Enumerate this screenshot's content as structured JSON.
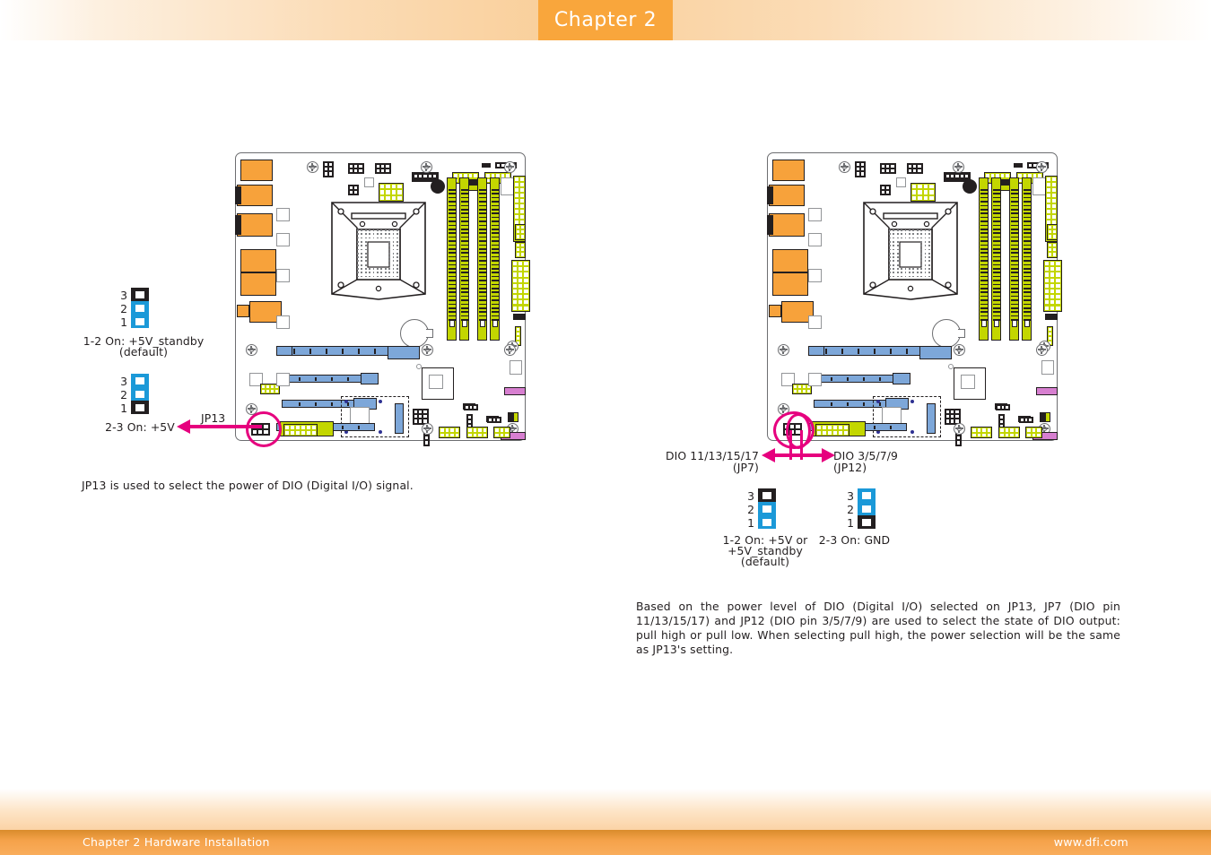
{
  "header": {
    "chapter_tab": "Chapter 2"
  },
  "footer": {
    "left": "Chapter 2 Hardware Installation",
    "right": "www.dfi.com"
  },
  "left_section": {
    "callout_label": "JP13",
    "jumpers": [
      {
        "id": "jp13-setting-1",
        "pins": [
          "3",
          "2",
          "1"
        ],
        "states": [
          "open",
          "capped",
          "capped"
        ],
        "caption": "1-2 On: +5V_standby",
        "caption2": "(default)"
      },
      {
        "id": "jp13-setting-2",
        "pins": [
          "3",
          "2",
          "1"
        ],
        "states": [
          "capped",
          "capped",
          "open"
        ],
        "caption": "2-3 On: +5V",
        "caption2": ""
      }
    ],
    "description": "JP13 is used to select the power of DIO (Digital I/O) signal."
  },
  "right_section": {
    "callout_left_line1": "DIO 11/13/15/17",
    "callout_left_line2": "(JP7)",
    "callout_right_line1": "DIO 3/5/7/9",
    "callout_right_line2": "(JP12)",
    "jumpers": [
      {
        "id": "jp7-setting",
        "pins": [
          "3",
          "2",
          "1"
        ],
        "states": [
          "open",
          "capped",
          "capped"
        ],
        "caption": "1-2 On: +5V or",
        "caption2": "+5V_standby",
        "caption3": "(default)"
      },
      {
        "id": "jp12-setting",
        "pins": [
          "3",
          "2",
          "1"
        ],
        "states": [
          "capped",
          "capped",
          "open"
        ],
        "caption": "2-3 On: GND",
        "caption2": "",
        "caption3": ""
      }
    ],
    "description": "Based on the power level of DIO (Digital I/O) selected on JP13, JP7 (DIO pin 11/13/15/17) and JP12 (DIO pin 3/5/7/9) are used to select the state of DIO output: pull high or pull low. When selecting pull high, the power selection will be the same as JP13's setting."
  },
  "colors": {
    "accent_orange": "#f9a63c",
    "highlight_magenta": "#e6007e",
    "jumper_cap_blue": "#1b99d8",
    "pin_black": "#231f20",
    "pcb_green": "#c3d600",
    "connector_orange": "#f7a23b",
    "slot_blue": "#7da7d9",
    "sata_pink": "#d77fd0"
  }
}
